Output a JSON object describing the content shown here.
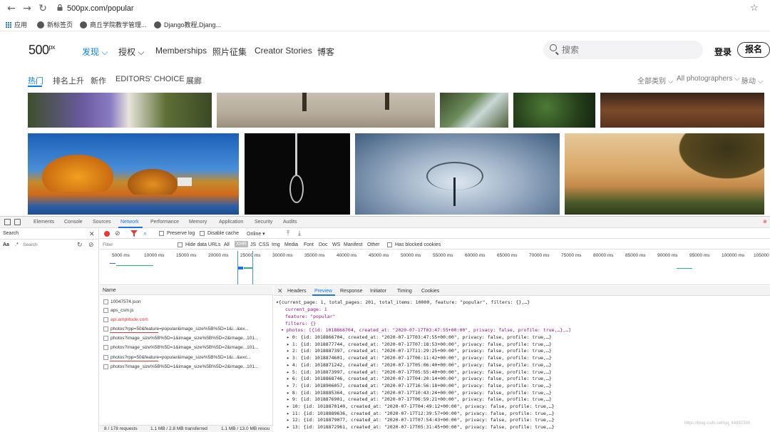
{
  "browser": {
    "url": "500px.com/popular",
    "bookmarks": [
      "应用",
      "新标签页",
      "商丘学院教学管理...",
      "Django教程,Djang..."
    ]
  },
  "site": {
    "logo": "500",
    "logo_sup": "px",
    "menu": [
      "发现",
      "授权",
      "Memberships",
      "照片征集",
      "Creator Stories",
      "博客"
    ],
    "search_placeholder": "搜索",
    "login": "登录",
    "signup": "报名",
    "subtabs": [
      "热门",
      "排名上升",
      "新作",
      "EDITORS' CHOICE",
      "展廊"
    ],
    "filters": [
      "全部类别",
      "All photographers",
      "脉动"
    ]
  },
  "devtools": {
    "tabs": [
      "Elements",
      "Console",
      "Sources",
      "Network",
      "Performance",
      "Memory",
      "Application",
      "Security",
      "Audits"
    ],
    "search_panel_title": "Search",
    "search_placeholder": "Search",
    "aa_label": "Aa",
    "dot_label": ".*",
    "toolbar": {
      "preserve_log": "Preserve log",
      "disable_cache": "Disable cache",
      "online": "Online"
    },
    "filter_bar": {
      "placeholder": "Filter",
      "hide_data_urls": "Hide data URLs",
      "types": [
        "All",
        "XHR",
        "JS",
        "CSS",
        "Img",
        "Media",
        "Font",
        "Doc",
        "WS",
        "Manifest",
        "Other"
      ],
      "has_blocked": "Has blocked cookies"
    },
    "timeline_ticks": [
      "5000 ms",
      "10000 ms",
      "15000 ms",
      "20000 ms",
      "25000 ms",
      "30000 ms",
      "35000 ms",
      "40000 ms",
      "45000 ms",
      "50000 ms",
      "55000 ms",
      "60000 ms",
      "65000 ms",
      "70000 ms",
      "75000 ms",
      "80000 ms",
      "85000 ms",
      "90000 ms",
      "95000 ms",
      "100000 ms",
      "105000"
    ],
    "name_header": "Name",
    "requests": [
      "10047574.json",
      "aps_csm.js",
      "api.amplitude.com",
      "photos?rpp=50&feature=popular&image_size%5B%5D=1&i...&ex...",
      "photos?image_size%5B%5D=1&image_size%5B%5D=2&image...101...",
      "photos?image_size%5B%5D=1&image_size%5B%5D=2&image...101...",
      "photos?rpp=50&feature=popular&image_size%5B%5D=1&i...&exc...",
      "photos?image_size%5B%5D=1&image_size%5B%5D=2&image...101..."
    ],
    "status_bar": [
      "8 / 178 requests",
      "1.1 MB / 2.8 MB transferred",
      "1.1 MB / 13.0 MB resou"
    ],
    "detail_tabs": [
      "Headers",
      "Preview",
      "Response",
      "Initiator",
      "Timing",
      "Cookies"
    ],
    "preview_summary": "{current_page: 1, total_pages: 201, total_items: 10000, feature: \"popular\", filters: {},…}",
    "preview_fields": [
      "current_page: 1",
      "feature: \"popular\"",
      "filters: {}"
    ],
    "photos_line": "photos: [{id: 1018866704, created_at: \"2020-07-17T03:47:55+00:00\", privacy: false, profile: true,…},…]",
    "photo_items": [
      "0: {id: 1018866704, created_at: \"2020-07-17T03:47:55+00:00\", privacy: false, profile: true,…}",
      "1: {id: 1018877744, created_at: \"2020-07-17T07:18:53+00:00\", privacy: false, profile: true,…}",
      "2: {id: 1018887397, created_at: \"2020-07-17T11:29:25+00:00\", privacy: false, profile: true,…}",
      "3: {id: 1018874601, created_at: \"2020-07-17T06:11:42+00:00\", privacy: false, profile: true,…}",
      "4: {id: 1018871242, created_at: \"2020-07-17T05:06:40+00:00\", privacy: false, profile: true,…}",
      "5: {id: 1018873997, created_at: \"2020-07-17T05:55:40+00:00\", privacy: false, profile: true,…}",
      "6: {id: 1018868746, created_at: \"2020-07-17T04:20:14+00:00\", privacy: false, profile: true,…}",
      "7: {id: 1018906057, created_at: \"2020-07-17T16:56:18+00:00\", privacy: false, profile: true,…}",
      "8: {id: 1018885364, created_at: \"2020-07-17T10:43:24+00:00\", privacy: false, profile: true,…}",
      "9: {id: 1018876901, created_at: \"2020-07-17T06:59:21+00:00\", privacy: false, profile: true,…}",
      "10: {id: 1018870140, created_at: \"2020-07-17T04:49:12+00:00\", privacy: false, profile: true,…}",
      "11: {id: 1018889636, created_at: \"2020-07-17T12:39:57+00:00\", privacy: false, profile: true,…}",
      "12: {id: 1018879077, created_at: \"2020-07-17T07:54:43+00:00\", privacy: false, profile: true,…}",
      "13: {id: 1018872961, created_at: \"2020-07-17T05:31:45+00:00\", privacy: false, profile: true,…}"
    ],
    "watermark": "https://blog.csdn.net/qq_44882330",
    "colors": {
      "accent": "#1a73e8",
      "site_blue": "#0a7cf5",
      "record_red": "#e53935"
    }
  }
}
